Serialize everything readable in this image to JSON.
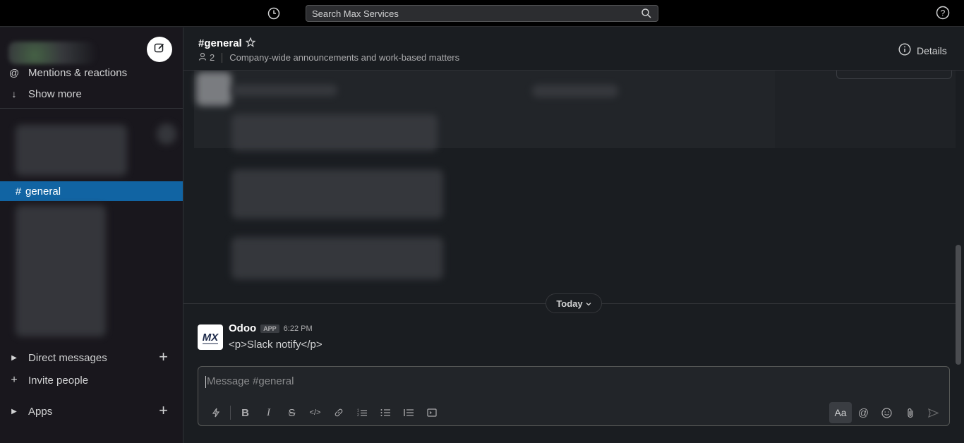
{
  "topbar": {
    "search_placeholder": "Search Max Services",
    "history_icon": "clock-icon",
    "help_icon": "help-icon"
  },
  "sidebar": {
    "compose_icon": "compose-icon",
    "nav": [
      {
        "label": "Mentions & reactions",
        "icon": "at-icon"
      },
      {
        "label": "Show more",
        "icon": "arrow-down-icon"
      }
    ],
    "active_channel": {
      "label": "general",
      "prefix": "#"
    },
    "sections": [
      {
        "label": "Direct messages",
        "icon": "caret-right-icon"
      },
      {
        "label": "Invite people",
        "icon": "plus-icon"
      },
      {
        "label": "Apps",
        "icon": "caret-right-icon"
      }
    ]
  },
  "channel": {
    "title": "#general",
    "member_count": "2",
    "topic": "Company-wide announcements and work-based matters",
    "details_label": "Details"
  },
  "divider": {
    "label": "Today"
  },
  "message": {
    "sender": "Odoo",
    "badge": "APP",
    "time": "6:22 PM",
    "text": "<p>Slack notify</p>",
    "avatar_text": "MX"
  },
  "composer": {
    "placeholder": "Message #general"
  },
  "colors": {
    "active_channel": "#1164a3",
    "background": "#1a1d21",
    "sidebar": "#19171d"
  }
}
